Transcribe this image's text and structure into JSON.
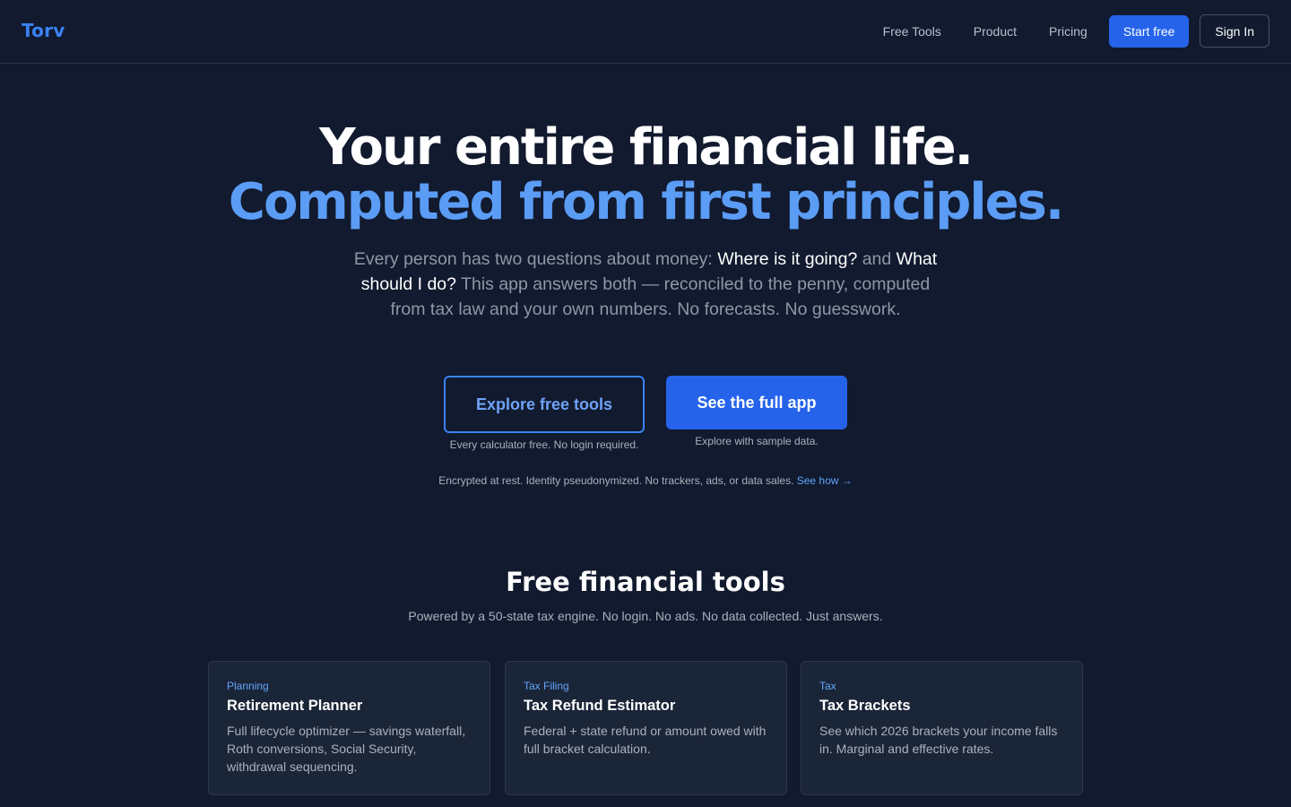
{
  "brand": {
    "name": "Torv"
  },
  "nav": {
    "free_tools": "Free Tools",
    "product": "Product",
    "pricing": "Pricing",
    "start_free": "Start free",
    "sign_in": "Sign In"
  },
  "hero": {
    "title_line1": "Your entire financial life.",
    "title_line2": "Computed from first principles.",
    "sub_part1": "Every person has two questions about money: ",
    "sub_q1": "Where is it going?",
    "sub_part2": " and ",
    "sub_q2": "What should I do?",
    "sub_part3": " This app answers both — reconciled to the penny, computed from tax law and your own numbers. No forecasts. No guesswork.",
    "cta_explore": "Explore free tools",
    "cta_explore_note": "Every calculator free. No login required.",
    "cta_app": "See the full app",
    "cta_app_note": "Explore with sample data.",
    "privacy_text": "Encrypted at rest. Identity pseudonymized. No trackers, ads, or data sales. ",
    "privacy_link": "See how →"
  },
  "tools": {
    "title": "Free financial tools",
    "subtitle": "Powered by a 50-state tax engine. No login. No ads. No data collected. Just answers.",
    "cards": [
      {
        "category": "Planning",
        "title": "Retirement Planner",
        "description": "Full lifecycle optimizer — savings waterfall, Roth conversions, Social Security, withdrawal sequencing."
      },
      {
        "category": "Tax Filing",
        "title": "Tax Refund Estimator",
        "description": "Federal + state refund or amount owed with full bracket calculation."
      },
      {
        "category": "Tax",
        "title": "Tax Brackets",
        "description": "See which 2026 brackets your income falls in. Marginal and effective rates."
      }
    ]
  },
  "colors": {
    "background": "#111a2e",
    "accent": "#2563eb",
    "accent_text": "#60a5fa",
    "headline_blue": "#5b9cf5"
  }
}
